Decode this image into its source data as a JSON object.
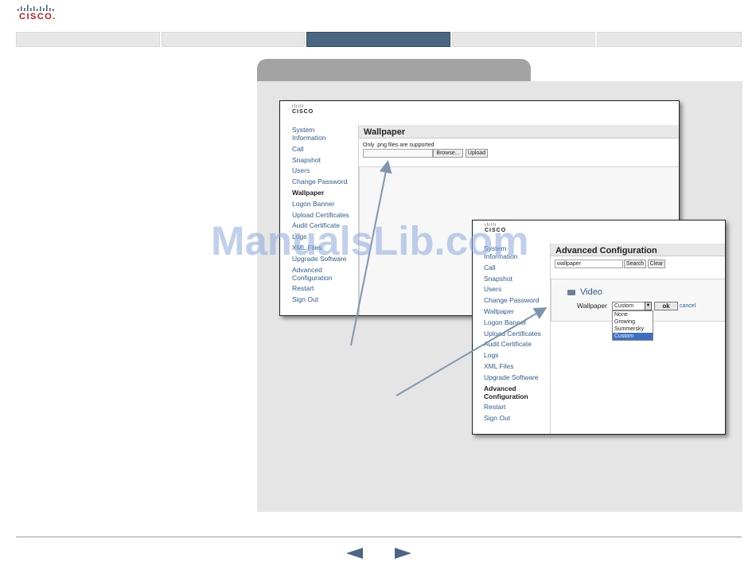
{
  "brand": {
    "logo_text": "CISCO."
  },
  "screenshot1": {
    "logo_text": "CISCO",
    "menu": [
      "System\nInformation",
      "Call",
      "Snapshot",
      "Users",
      "Change Password",
      "Wallpaper",
      "Logon Banner",
      "Upload Certificates",
      "Audit Certificate",
      "Logs",
      "XML Files",
      "Upgrade Software",
      "Advanced\nConfiguration",
      "Restart",
      "Sign Out"
    ],
    "active_menu_index": 5,
    "header": "Wallpaper",
    "note": "Only .png files are supported",
    "browse_label": "Browse...",
    "upload_label": "Upload"
  },
  "screenshot2": {
    "logo_text": "CISCO",
    "menu": [
      "System\nInformation",
      "Call",
      "Snapshot",
      "Users",
      "Change Password",
      "Wallpaper",
      "Logon Banner",
      "Upload Certificates",
      "Audit Certificate",
      "Logs",
      "XML Files",
      "Upgrade Software",
      "Advanced\nConfiguration",
      "Restart",
      "Sign Out"
    ],
    "active_menu_index": 12,
    "header": "Advanced Configuration",
    "search_value": "wallpaper",
    "search_label": "Search",
    "clear_label": "Clear",
    "section_title": "Video",
    "setting_label": "Wallpaper",
    "select_value": "Custom",
    "options": [
      "None",
      "Growing",
      "Summersky",
      "Custom"
    ],
    "selected_option_index": 3,
    "ok_label": "ok",
    "cancel_label": "cancel"
  },
  "watermark": "ManualsLib.com",
  "colors": {
    "accent": "#4a6682",
    "link": "#2b5c9b",
    "cisco_red": "#c41a1a",
    "panel": "#e5e5e5"
  },
  "icons": {
    "prev": "triangle-left-icon",
    "next": "triangle-right-icon",
    "folder": "folder-icon"
  }
}
